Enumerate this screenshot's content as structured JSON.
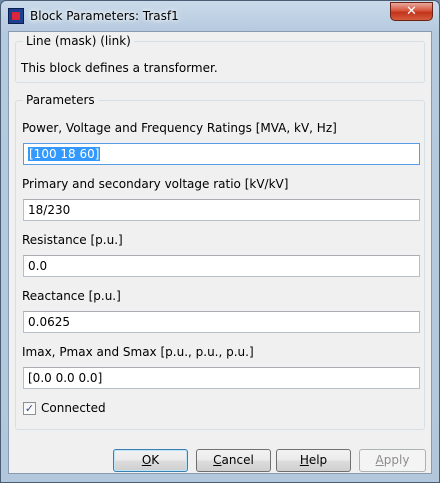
{
  "window": {
    "title": "Block Parameters: Trasf1",
    "close_glyph": "✕"
  },
  "mask": {
    "legend": "Line (mask) (link)",
    "description": "This block defines a transformer."
  },
  "parameters": {
    "legend": "Parameters",
    "fields": [
      {
        "label": "Power, Voltage and Frequency Ratings [MVA, kV, Hz]",
        "value": "[100  18  60]"
      },
      {
        "label": "Primary and secondary voltage ratio [kV/kV]",
        "value": "18/230"
      },
      {
        "label": "Resistance [p.u.]",
        "value": "0.0"
      },
      {
        "label": "Reactance [p.u.]",
        "value": "0.0625"
      },
      {
        "label": "Imax, Pmax and Smax [p.u., p.u., p.u.]",
        "value": "[0.0  0.0  0.0]"
      }
    ],
    "connected_label": "Connected",
    "connected_checked": true,
    "check_glyph": "✓"
  },
  "buttons": {
    "ok": {
      "mnemonic": "O",
      "rest": "K"
    },
    "cancel": {
      "mnemonic": "C",
      "rest": "ancel"
    },
    "help": {
      "mnemonic": "H",
      "rest": "elp"
    },
    "apply": {
      "mnemonic": "A",
      "rest": "pply"
    }
  }
}
